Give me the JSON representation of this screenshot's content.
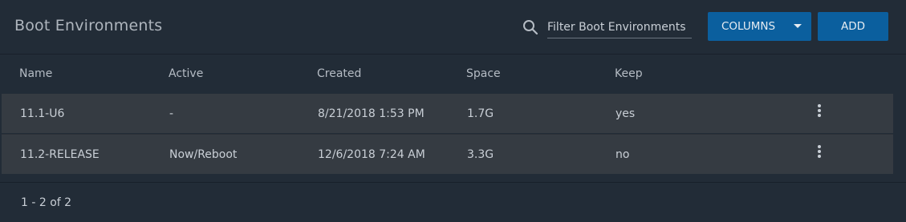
{
  "toolbar": {
    "title": "Boot Environments",
    "search_placeholder": "Filter Boot Environments",
    "columns_label": "COLUMNS",
    "add_label": "ADD"
  },
  "table": {
    "columns": [
      "Name",
      "Active",
      "Created",
      "Space",
      "Keep"
    ],
    "rows": [
      {
        "name": "11.1-U6",
        "active": "-",
        "created": "8/21/2018 1:53 PM",
        "space": "1.7G",
        "keep": "yes"
      },
      {
        "name": "11.2-RELEASE",
        "active": "Now/Reboot",
        "created": "12/6/2018 7:24 AM",
        "space": "3.3G",
        "keep": "no"
      }
    ]
  },
  "footer": {
    "range": "1 - 2 of 2"
  },
  "icons": {
    "search": "search-icon",
    "caret": "chevron-down-icon",
    "row_menu": "more-vert-icon"
  },
  "colors": {
    "background": "#222c37",
    "row": "#353b42",
    "accent": "#0b5f9e"
  }
}
